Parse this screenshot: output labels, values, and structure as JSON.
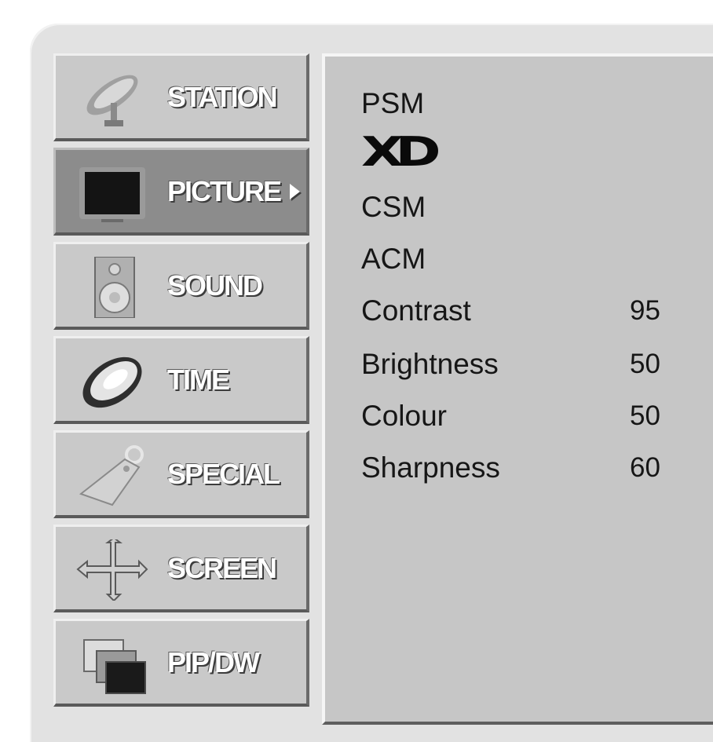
{
  "menu": {
    "items": [
      {
        "label": "STATION",
        "icon": "satellite-dish-icon",
        "selected": false
      },
      {
        "label": "PICTURE",
        "icon": "tv-screen-icon",
        "selected": true
      },
      {
        "label": "SOUND",
        "icon": "speaker-icon",
        "selected": false
      },
      {
        "label": "TIME",
        "icon": "clock-icon",
        "selected": false
      },
      {
        "label": "SPECIAL",
        "icon": "tag-icon",
        "selected": false
      },
      {
        "label": "SCREEN",
        "icon": "move-arrows-icon",
        "selected": false
      },
      {
        "label": "PIP/DW",
        "icon": "pip-windows-icon",
        "selected": false
      }
    ]
  },
  "picture_menu": {
    "logo": "XD",
    "rows": [
      {
        "label": "PSM",
        "value": ""
      },
      {
        "label": "CSM",
        "value": ""
      },
      {
        "label": "ACM",
        "value": ""
      },
      {
        "label": "Contrast",
        "value": "95"
      },
      {
        "label": "Brightness",
        "value": "50"
      },
      {
        "label": "Colour",
        "value": "50"
      },
      {
        "label": "Sharpness",
        "value": "60"
      }
    ]
  },
  "colors": {
    "menu_bg": "#c9c9c9",
    "menu_selected_bg": "#8c8c8c",
    "panel_bg": "#c6c6c6",
    "frame_bg": "#e2e2e2"
  }
}
